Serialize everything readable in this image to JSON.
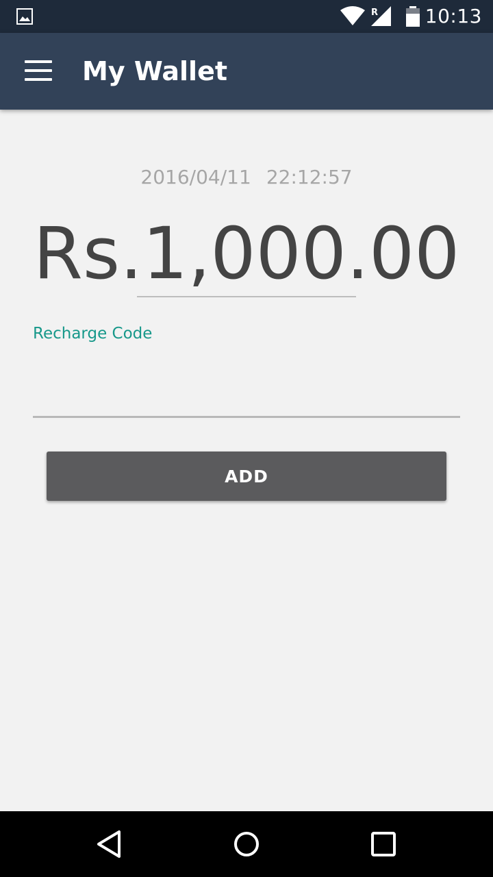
{
  "status_bar": {
    "time": "10:13",
    "icons": [
      "image-notification-icon",
      "wifi-icon",
      "signal-roaming-icon",
      "battery-icon"
    ],
    "roaming_indicator": "R"
  },
  "app_bar": {
    "title": "My Wallet",
    "menu_icon": "hamburger-menu-icon"
  },
  "wallet": {
    "date": "2016/04/11",
    "time": "22:12:57",
    "balance": "Rs.1,000.00"
  },
  "recharge": {
    "label": "Recharge Code",
    "value": "",
    "button_label": "ADD"
  },
  "nav_bar": {
    "icons": [
      "back-icon",
      "home-icon",
      "recents-icon"
    ]
  },
  "colors": {
    "status_bar": "#1e2a3a",
    "app_bar": "#324258",
    "background": "#f2f2f2",
    "accent_label": "#17988a",
    "button": "#5b5b5d",
    "balance_text": "#444444"
  }
}
